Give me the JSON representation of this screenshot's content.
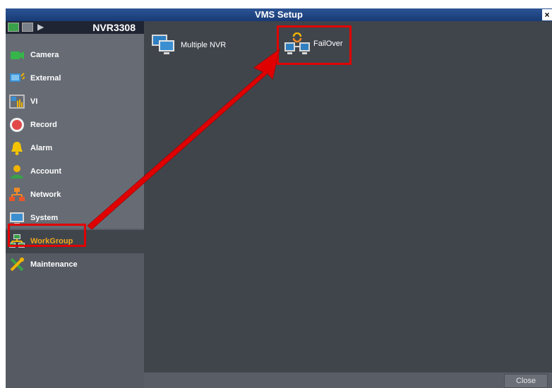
{
  "window": {
    "title": "VMS Setup",
    "close_glyph": "×"
  },
  "sidebar": {
    "model": "NVR3308",
    "items": [
      {
        "label": "Camera",
        "icon": "camera-icon"
      },
      {
        "label": "External",
        "icon": "external-icon"
      },
      {
        "label": "VI",
        "icon": "vi-icon"
      },
      {
        "label": "Record",
        "icon": "record-icon"
      },
      {
        "label": "Alarm",
        "icon": "alarm-bell-icon"
      },
      {
        "label": "Account",
        "icon": "account-icon"
      },
      {
        "label": "Network",
        "icon": "network-icon"
      },
      {
        "label": "System",
        "icon": "system-monitor-icon"
      },
      {
        "label": "WorkGroup",
        "icon": "workgroup-icon",
        "selected": true
      },
      {
        "label": "Maintenance",
        "icon": "maintenance-tools-icon"
      }
    ]
  },
  "main": {
    "tiles": [
      {
        "label": "Multiple NVR",
        "icon": "multiple-nvr-icon"
      },
      {
        "label": "FailOver",
        "icon": "failover-icon"
      }
    ]
  },
  "footer": {
    "close_label": "Close"
  },
  "colors": {
    "highlight": "#e10000",
    "titlebar": "#1f4786",
    "content": "#40454c",
    "sidebar": "#666b74"
  }
}
